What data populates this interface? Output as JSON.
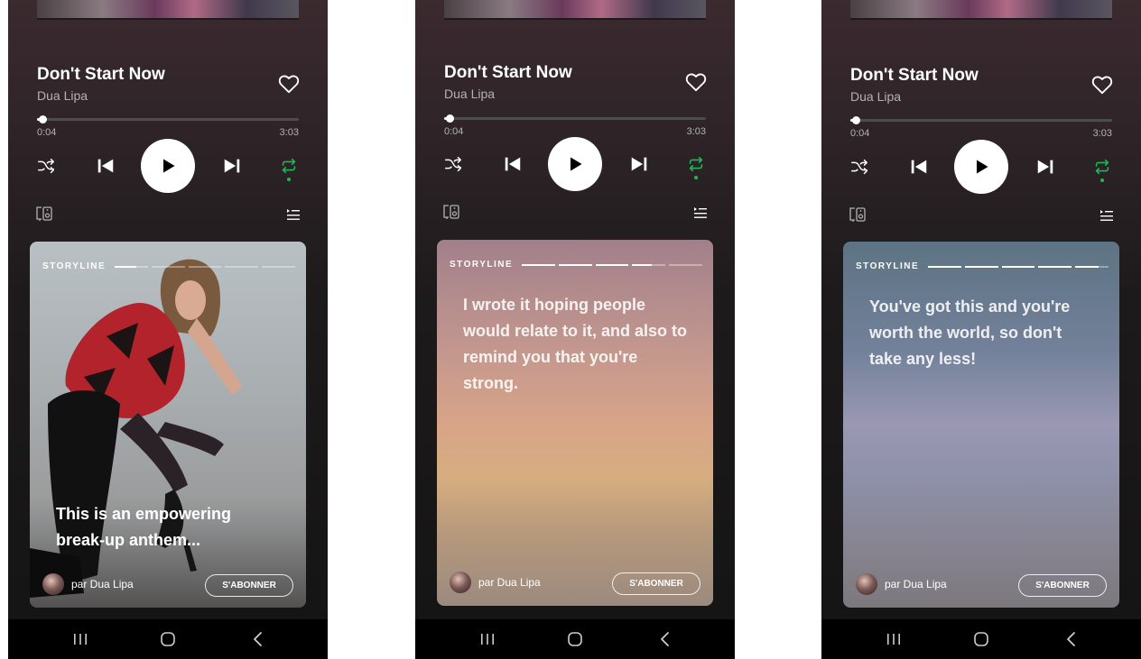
{
  "song": {
    "title": "Don't Start Now",
    "artist": "Dua Lipa"
  },
  "playback": {
    "current_time": "0:04",
    "total_time": "3:03",
    "progress_fraction": 0.022
  },
  "storyline": {
    "label": "STORYLINE",
    "author": "par Dua Lipa",
    "subscribe_label": "S'ABONNER",
    "cards": [
      {
        "quote": "This is an empowering break-up anthem...",
        "segments_total": 5,
        "segments_filled": 0,
        "active_fill": 0.65
      },
      {
        "quote": "I wrote it hoping people would relate to it, and also to remind you that you're strong.",
        "segments_total": 5,
        "segments_filled": 3,
        "active_fill": 0.6
      },
      {
        "quote": "You've got this and you're worth the world, so don't take any less!",
        "segments_total": 5,
        "segments_filled": 4,
        "active_fill": 0.7
      }
    ]
  },
  "colors": {
    "accent": "#1db954",
    "background": "#141414"
  },
  "icons": {
    "like": "heart-icon",
    "shuffle": "shuffle-icon",
    "previous": "skip-previous-icon",
    "play": "play-icon",
    "next": "skip-next-icon",
    "repeat": "repeat-icon",
    "devices": "devices-icon",
    "queue": "queue-icon",
    "nav_recents": "recents-icon",
    "nav_home": "home-icon",
    "nav_back": "back-icon"
  }
}
